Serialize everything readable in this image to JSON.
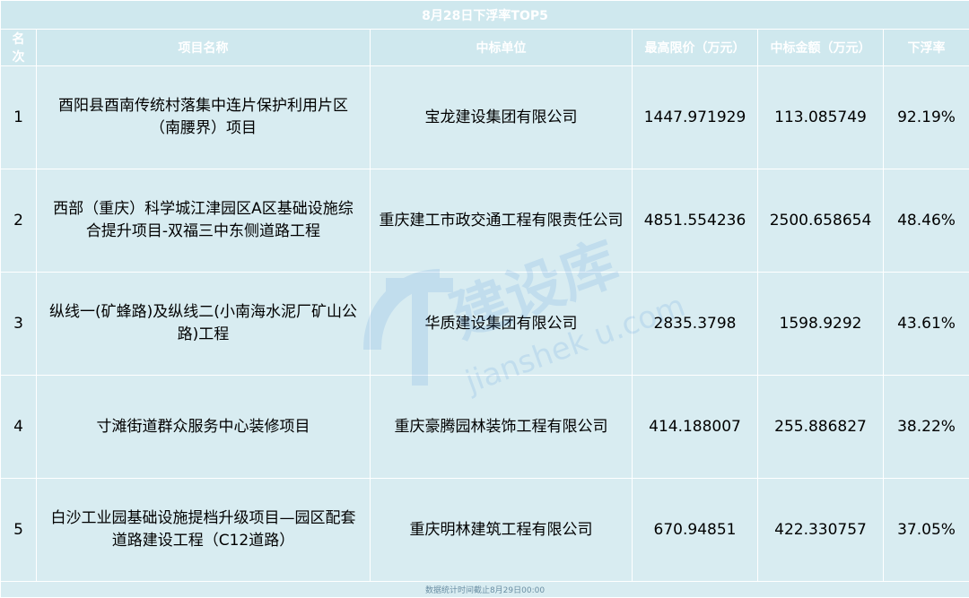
{
  "title": "8月28日下浮率TOP5",
  "headers": [
    "名次",
    "项目名称",
    "中标单位",
    "最高限价（万元）",
    "中标金额（万元）",
    "下浮率"
  ],
  "rows": [
    {
      "rank": "1",
      "project": "酉阳县酉南传统村落集中连片保护利用片区（南腰界）项目",
      "winner": "宝龙建设集团有限公司",
      "max_price": "1447.971929",
      "bid_amount": "113.085749",
      "rate": "92.19%"
    },
    {
      "rank": "2",
      "project": "西部（重庆）科学城江津园区A区基础设施综合提升项目-双福三中东侧道路工程",
      "winner": "重庆建工市政交通工程有限责任公司",
      "max_price": "4851.554236",
      "bid_amount": "2500.658654",
      "rate": "48.46%"
    },
    {
      "rank": "3",
      "project": "纵线一(矿蜂路)及纵线二(小南海水泥厂矿山公路)工程",
      "winner": "华质建设集团有限公司",
      "max_price": "2835.3798",
      "bid_amount": "1598.9292",
      "rate": "43.61%"
    },
    {
      "rank": "4",
      "project": "寸滩街道群众服务中心装修项目",
      "winner": "重庆豪腾园林装饰工程有限公司",
      "max_price": "414.188007",
      "bid_amount": "255.886827",
      "rate": "38.22%"
    },
    {
      "rank": "5",
      "project": "白沙工业园基础设施提档升级项目—园区配套道路建设工程（C12道路）",
      "winner": "重庆明林建筑工程有限公司",
      "max_price": "670.94851",
      "bid_amount": "422.330757",
      "rate": "37.05%"
    }
  ],
  "footer": "数据统计时间截止8月29日00:00",
  "watermark": {
    "brand": "建设库",
    "url": "jianshek u.com"
  },
  "colors": {
    "header_bg": "#cfe8ee",
    "row_bg": "#d8ecf1",
    "border": "#ffffff",
    "header_text": "#ffffff"
  }
}
